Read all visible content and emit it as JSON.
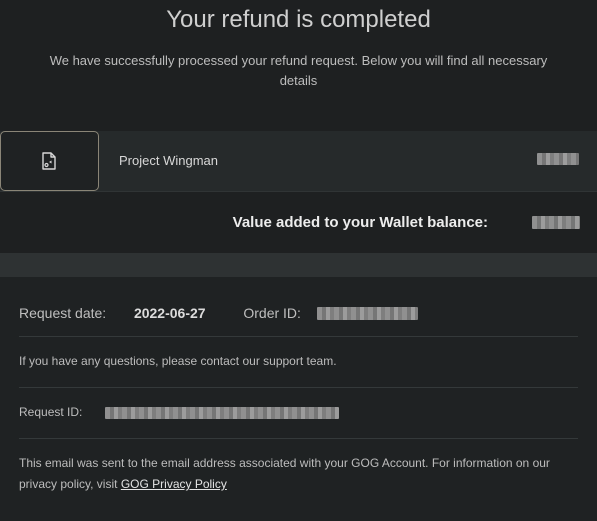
{
  "header": {
    "title": "Your refund is completed",
    "subtitle": "We have successfully processed your refund request. Below you will find all necessary details"
  },
  "product": {
    "name": "Project Wingman",
    "icon": "game-file-icon"
  },
  "wallet": {
    "label": "Value added to your Wallet balance:"
  },
  "details": {
    "request_date_label": "Request date:",
    "request_date_value": "2022-06-27",
    "order_id_label": "Order ID:",
    "support_text": "If you have any questions, please contact our support team.",
    "request_id_label": "Request ID:",
    "footer_text": "This email was sent to the email address associated with your GOG Account. For information on our privacy policy, visit ",
    "privacy_link": "GOG Privacy Policy"
  }
}
